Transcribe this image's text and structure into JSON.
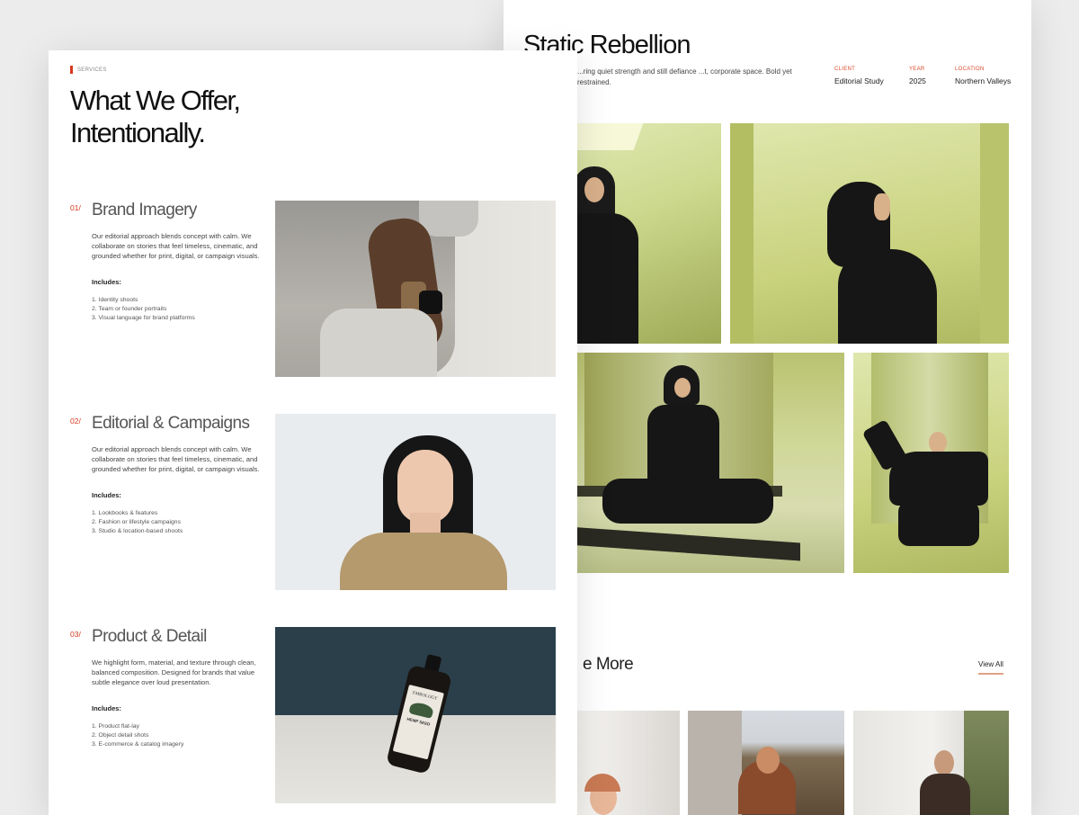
{
  "back_page": {
    "title": "Static Rebellion",
    "description": "...ring quiet strength and still defiance ...t, corporate space. Bold yet restrained.",
    "meta": [
      {
        "label": "CLIENT",
        "value": "Editorial Study"
      },
      {
        "label": "YEAR",
        "value": "2025"
      },
      {
        "label": "LOCATION",
        "value": "Northern Valleys"
      }
    ],
    "see_more_heading": "e More",
    "view_all_label": "View All"
  },
  "front_page": {
    "breadcrumb": "SERVICES",
    "headline_line1": "What We Offer,",
    "headline_line2": "Intentionally.",
    "includes_label": "Includes:",
    "services": [
      {
        "number": "01/",
        "title": "Brand Imagery",
        "description": "Our editorial approach blends concept with calm. We collaborate on stories that feel timeless, cinematic, and grounded whether for print, digital, or campaign visuals.",
        "items": [
          "1. Identity shoots",
          "2. Team or founder portraits",
          "3. Visual language for brand platforms"
        ]
      },
      {
        "number": "02/",
        "title": "Editorial & Campaigns",
        "description": "Our editorial approach blends concept with calm. We collaborate on stories that feel timeless, cinematic, and grounded whether for print, digital, or campaign visuals.",
        "items": [
          "1. Lookbooks & features",
          "2. Fashion or lifestyle campaigns",
          "3. Studio & location-based shoots"
        ]
      },
      {
        "number": "03/",
        "title": "Product & Detail",
        "description": "We highlight form, material, and texture through clean, balanced composition. Designed for brands that value subtle elegance over loud presentation.",
        "items": [
          "1. Product flat-lay",
          "2. Object detail shots",
          "3. E-commerce & catalog imagery"
        ]
      }
    ],
    "product_label": {
      "brand": "EMBOLOGY",
      "name": "HEMP SEED"
    }
  },
  "colors": {
    "accent": "#d9381e",
    "link_underline": "#e0a187",
    "green_photo": "#cdd98e"
  }
}
